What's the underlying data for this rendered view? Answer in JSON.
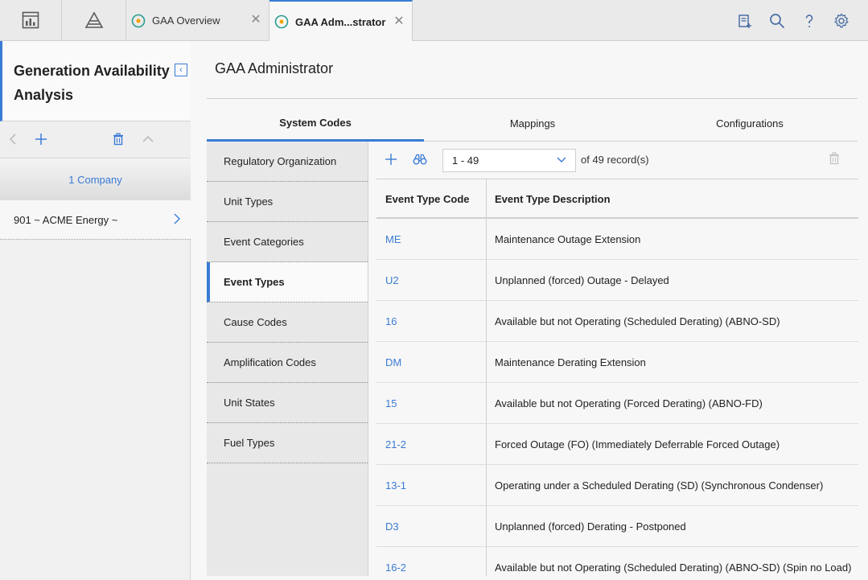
{
  "top_tabs": [
    {
      "label": "GAA Overview",
      "active": false
    },
    {
      "label": "GAA Adm...strator",
      "active": true
    }
  ],
  "left_panel": {
    "title": "Generation Availability Analysis",
    "company_header": "1 Company",
    "items": [
      {
        "label": "901 ~ ACME Energy ~"
      }
    ]
  },
  "main": {
    "title": "GAA Administrator",
    "tabs": [
      {
        "label": "System Codes",
        "active": true
      },
      {
        "label": "Mappings",
        "active": false
      },
      {
        "label": "Configurations",
        "active": false
      }
    ],
    "system_codes": [
      {
        "label": "Regulatory Organization",
        "active": false
      },
      {
        "label": "Unit Types",
        "active": false
      },
      {
        "label": "Event Categories",
        "active": false
      },
      {
        "label": "Event Types",
        "active": true
      },
      {
        "label": "Cause Codes",
        "active": false
      },
      {
        "label": "Amplification Codes",
        "active": false
      },
      {
        "label": "Unit States",
        "active": false
      },
      {
        "label": "Fuel Types",
        "active": false
      }
    ],
    "grid_toolbar": {
      "range_value": "1 - 49",
      "record_count_text": "of 49 record(s)"
    },
    "grid": {
      "columns": [
        "Event Type Code",
        "Event Type Description"
      ],
      "rows": [
        {
          "code": "ME",
          "description": "Maintenance Outage Extension"
        },
        {
          "code": "U2",
          "description": "Unplanned (forced) Outage - Delayed"
        },
        {
          "code": "16",
          "description": "Available but not Operating (Scheduled Derating) (ABNO-SD)"
        },
        {
          "code": "DM",
          "description": "Maintenance Derating Extension"
        },
        {
          "code": "15",
          "description": "Available but not Operating (Forced Derating) (ABNO-FD)"
        },
        {
          "code": "21-2",
          "description": "Forced Outage (FO) (Immediately Deferrable Forced Outage)"
        },
        {
          "code": "13-1",
          "description": "Operating under a Scheduled Derating (SD) (Synchronous Condenser)"
        },
        {
          "code": "D3",
          "description": "Unplanned (forced) Derating - Postponed"
        },
        {
          "code": "16-2",
          "description": "Available but not Operating (Scheduled Derating) (ABNO-SD) (Spin no Load)"
        }
      ]
    }
  },
  "colors": {
    "accent": "#3a7bd5",
    "icon": "#5a5a5a"
  },
  "icons": [
    "dashboard-icon",
    "pyramid-icon",
    "tab-app-icon",
    "close-icon",
    "clipboard-add-icon",
    "search-icon",
    "help-icon",
    "gear-icon",
    "chevron-left-icon",
    "plus-icon",
    "trash-icon",
    "chevron-up-icon",
    "chevron-right-icon",
    "binoculars-icon",
    "chevron-down-icon"
  ]
}
